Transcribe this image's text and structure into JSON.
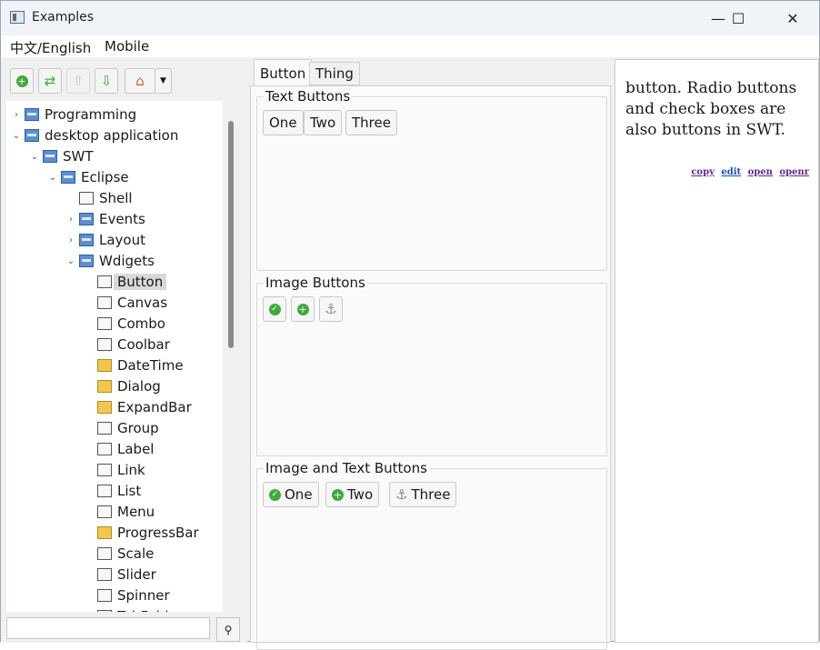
{
  "window": {
    "title": "Examples",
    "minimize": "—",
    "maximize": "☐",
    "close": "✕"
  },
  "menu": {
    "items": [
      "中文/English",
      "Mobile"
    ]
  },
  "toolbar": {
    "icons": [
      "add-icon",
      "refresh-icon",
      "up-arrow-icon",
      "down-arrow-icon",
      "home-icon",
      "dropdown-icon"
    ]
  },
  "tree": {
    "nodes": [
      {
        "label": "Programming",
        "depth": 0,
        "toggle": "›",
        "icon": "html"
      },
      {
        "label": "desktop application",
        "depth": 0,
        "toggle": "⌄",
        "icon": "html"
      },
      {
        "label": "SWT",
        "depth": 1,
        "toggle": "⌄",
        "icon": "html"
      },
      {
        "label": "Eclipse",
        "depth": 2,
        "toggle": "⌄",
        "icon": "html"
      },
      {
        "label": "Shell",
        "depth": 3,
        "toggle": "",
        "icon": "leaf"
      },
      {
        "label": "Events",
        "depth": 3,
        "toggle": "›",
        "icon": "html"
      },
      {
        "label": "Layout",
        "depth": 3,
        "toggle": "›",
        "icon": "html"
      },
      {
        "label": "Wdigets",
        "depth": 3,
        "toggle": "⌄",
        "icon": "html"
      },
      {
        "label": "Button",
        "depth": 4,
        "toggle": "",
        "icon": "leaf",
        "selected": true
      },
      {
        "label": "Canvas",
        "depth": 4,
        "toggle": "",
        "icon": "leaf"
      },
      {
        "label": "Combo",
        "depth": 4,
        "toggle": "",
        "icon": "leaf"
      },
      {
        "label": "Coolbar",
        "depth": 4,
        "toggle": "",
        "icon": "leaf"
      },
      {
        "label": "DateTime",
        "depth": 4,
        "toggle": "",
        "icon": "folder"
      },
      {
        "label": "Dialog",
        "depth": 4,
        "toggle": "",
        "icon": "folder"
      },
      {
        "label": "ExpandBar",
        "depth": 4,
        "toggle": "",
        "icon": "folder"
      },
      {
        "label": "Group",
        "depth": 4,
        "toggle": "",
        "icon": "leaf"
      },
      {
        "label": "Label",
        "depth": 4,
        "toggle": "",
        "icon": "leaf"
      },
      {
        "label": "Link",
        "depth": 4,
        "toggle": "",
        "icon": "leaf"
      },
      {
        "label": "List",
        "depth": 4,
        "toggle": "",
        "icon": "leaf"
      },
      {
        "label": "Menu",
        "depth": 4,
        "toggle": "",
        "icon": "leaf"
      },
      {
        "label": "ProgressBar",
        "depth": 4,
        "toggle": "",
        "icon": "folder"
      },
      {
        "label": "Scale",
        "depth": 4,
        "toggle": "",
        "icon": "leaf"
      },
      {
        "label": "Slider",
        "depth": 4,
        "toggle": "",
        "icon": "leaf"
      },
      {
        "label": "Spinner",
        "depth": 4,
        "toggle": "",
        "icon": "leaf"
      },
      {
        "label": "TabFolder",
        "depth": 4,
        "toggle": "",
        "icon": "leaf"
      }
    ]
  },
  "search": {
    "value": "",
    "placeholder": ""
  },
  "tabs": [
    "Button",
    "Thing"
  ],
  "groups": {
    "text": {
      "label": "Text Buttons",
      "buttons": [
        "One",
        "Two",
        "Three"
      ]
    },
    "image": {
      "label": "Image Buttons",
      "icons": [
        "check-icon",
        "add-icon",
        "anchor-icon"
      ]
    },
    "image_text": {
      "label": "Image and Text Buttons",
      "buttons": [
        "One",
        "Two",
        "Three"
      ]
    }
  },
  "doc": {
    "text": "button. Radio buttons and check boxes are also buttons in SWT.",
    "links": [
      "copy",
      "edit",
      "open",
      "openr"
    ]
  }
}
